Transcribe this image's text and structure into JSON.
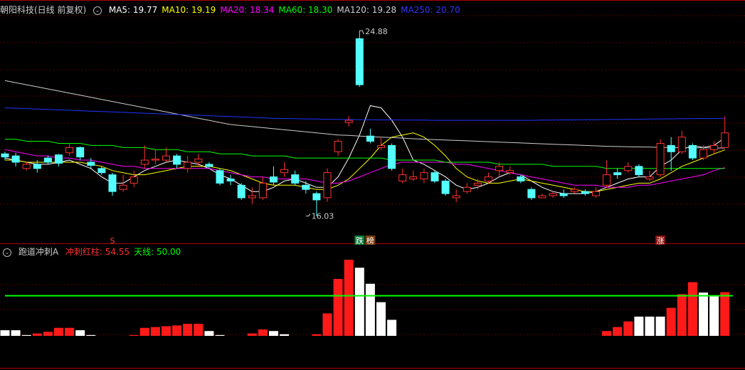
{
  "main_header": {
    "title": "朝阳科技(日线 前复权)",
    "ma_labels": [
      {
        "text": "MA5: 19.77",
        "color": "#ffffff"
      },
      {
        "text": "MA10: 19.19",
        "color": "#ffff00"
      },
      {
        "text": "MA20: 18.34",
        "color": "#ff00ff"
      },
      {
        "text": "MA60: 18.30",
        "color": "#00ff00"
      },
      {
        "text": "MA120: 19.28",
        "color": "#cccccc"
      },
      {
        "text": "MA250: 20.70",
        "color": "#3333ff"
      }
    ]
  },
  "sub_header": {
    "title": "跑道冲刺A",
    "items": [
      {
        "text": "冲刺红柱: 54.55",
        "color": "#ff3333"
      },
      {
        "text": "天线: 50.00",
        "color": "#00ff00"
      }
    ]
  },
  "chart_data": [
    {
      "type": "candlestick",
      "title": "朝阳科技(日线 前复权)",
      "ylim": [
        15.2,
        25.6
      ],
      "annotations": {
        "high": {
          "label": "24.88",
          "value": 24.88,
          "index": 33
        },
        "low": {
          "label": "16.03",
          "value": 16.03,
          "index": 28
        },
        "markers": [
          {
            "text": "S",
            "index": 10,
            "color": "#ff3333"
          },
          {
            "text": "跌",
            "index": 33,
            "color": "#ffffff",
            "bg": "#0a7a3a"
          },
          {
            "text": "榜",
            "index": 34,
            "color": "#ffffff",
            "bg": "#7a3a0a"
          },
          {
            "text": "涨",
            "index": 61,
            "color": "#ffffff",
            "bg": "#8a1010"
          }
        ]
      },
      "candles": [
        [
          19.0,
          18.85,
          19.1,
          18.7
        ],
        [
          18.9,
          18.6,
          19.05,
          18.4
        ],
        [
          18.3,
          18.5,
          18.6,
          18.2
        ],
        [
          18.5,
          18.3,
          18.7,
          18.1
        ],
        [
          18.8,
          18.6,
          18.9,
          18.5
        ],
        [
          18.95,
          18.55,
          19.0,
          18.4
        ],
        [
          19.05,
          19.3,
          19.5,
          18.9
        ],
        [
          19.3,
          18.85,
          19.35,
          18.7
        ],
        [
          18.6,
          18.45,
          18.8,
          18.3
        ],
        [
          18.3,
          18.1,
          18.4,
          18.0
        ],
        [
          18.0,
          17.2,
          18.1,
          17.0
        ],
        [
          17.3,
          17.5,
          18.0,
          17.2
        ],
        [
          17.6,
          17.9,
          18.2,
          17.4
        ],
        [
          18.5,
          18.7,
          19.4,
          18.3
        ],
        [
          18.7,
          18.75,
          19.2,
          18.5
        ],
        [
          18.7,
          18.9,
          19.3,
          18.6
        ],
        [
          18.9,
          18.5,
          19.0,
          18.3
        ],
        [
          18.3,
          18.6,
          18.9,
          18.1
        ],
        [
          18.6,
          18.75,
          19.0,
          18.4
        ],
        [
          18.5,
          18.4,
          18.6,
          18.3
        ],
        [
          18.2,
          17.6,
          18.3,
          17.5
        ],
        [
          17.8,
          17.7,
          18.0,
          17.5
        ],
        [
          17.5,
          16.9,
          17.6,
          16.8
        ],
        [
          16.9,
          17.0,
          17.4,
          16.6
        ],
        [
          16.9,
          17.6,
          17.9,
          16.8
        ],
        [
          17.9,
          17.65,
          18.4,
          17.5
        ],
        [
          18.1,
          18.25,
          18.6,
          17.9
        ],
        [
          18.0,
          17.6,
          18.2,
          17.5
        ],
        [
          17.5,
          17.3,
          17.7,
          17.1
        ],
        [
          17.1,
          16.8,
          17.2,
          16.03
        ],
        [
          16.9,
          18.1,
          18.3,
          16.7
        ],
        [
          19.1,
          19.6,
          19.7,
          18.9
        ],
        [
          20.5,
          20.6,
          20.8,
          20.3
        ],
        [
          24.5,
          22.3,
          24.88,
          22.2
        ],
        [
          19.85,
          19.6,
          20.2,
          19.5
        ],
        [
          19.3,
          19.4,
          19.8,
          19.2
        ],
        [
          19.4,
          18.3,
          19.5,
          18.2
        ],
        [
          17.7,
          18.0,
          18.3,
          17.6
        ],
        [
          17.8,
          17.9,
          18.2,
          17.7
        ],
        [
          17.8,
          18.1,
          18.3,
          17.6
        ],
        [
          18.1,
          17.7,
          18.2,
          17.6
        ],
        [
          17.7,
          17.1,
          17.8,
          17.0
        ],
        [
          16.9,
          17.0,
          17.3,
          16.7
        ],
        [
          17.2,
          17.4,
          17.6,
          17.1
        ],
        [
          17.5,
          17.6,
          17.8,
          17.3
        ],
        [
          17.7,
          17.9,
          18.1,
          17.6
        ],
        [
          18.2,
          18.4,
          18.6,
          17.9
        ],
        [
          18.1,
          18.2,
          18.4,
          18.0
        ],
        [
          17.9,
          17.7,
          18.0,
          17.6
        ],
        [
          17.3,
          16.9,
          17.4,
          16.8
        ],
        [
          16.9,
          17.0,
          17.1,
          16.9
        ],
        [
          17.0,
          17.1,
          17.2,
          16.9
        ],
        [
          17.1,
          17.0,
          17.3,
          16.9
        ],
        [
          17.2,
          17.3,
          17.4,
          17.1
        ],
        [
          17.2,
          17.1,
          17.3,
          17.0
        ],
        [
          17.0,
          17.2,
          17.4,
          16.9
        ],
        [
          17.5,
          18.0,
          18.7,
          17.4
        ],
        [
          18.1,
          18.0,
          18.3,
          17.8
        ],
        [
          18.2,
          18.4,
          18.6,
          18.1
        ],
        [
          18.4,
          18.0,
          18.5,
          17.9
        ],
        [
          17.8,
          17.9,
          18.2,
          17.7
        ],
        [
          18.0,
          19.5,
          19.7,
          17.9
        ],
        [
          19.4,
          19.1,
          19.8,
          18.2
        ],
        [
          19.1,
          19.8,
          20.1,
          19.0
        ],
        [
          19.4,
          18.8,
          19.5,
          18.7
        ],
        [
          18.8,
          19.2,
          19.4,
          18.7
        ],
        [
          19.2,
          19.4,
          19.6,
          19.0
        ],
        [
          19.3,
          20.0,
          20.8,
          19.3
        ]
      ],
      "series": [
        {
          "name": "MA5",
          "color": "#ffffff",
          "values": [
            18.8,
            18.7,
            18.6,
            18.5,
            18.5,
            18.6,
            18.7,
            18.5,
            18.3,
            17.9,
            17.6,
            17.6,
            17.9,
            18.2,
            18.4,
            18.6,
            18.7,
            18.6,
            18.5,
            18.3,
            18.0,
            17.8,
            17.5,
            17.2,
            17.2,
            17.4,
            17.7,
            17.8,
            17.6,
            17.4,
            17.4,
            17.9,
            18.8,
            19.9,
            21.3,
            21.2,
            20.6,
            19.8,
            18.7,
            18.5,
            18.2,
            17.9,
            17.5,
            17.3,
            17.4,
            17.6,
            17.9,
            18.1,
            18.0,
            17.7,
            17.4,
            17.2,
            17.1,
            17.1,
            17.1,
            17.2,
            17.4,
            17.6,
            17.8,
            17.9,
            17.9,
            18.4,
            18.7,
            19.2,
            19.4,
            19.3,
            19.4,
            19.77
          ]
        },
        {
          "name": "MA10",
          "color": "#ffff00",
          "values": [
            18.7,
            18.7,
            18.6,
            18.6,
            18.6,
            18.6,
            18.6,
            18.6,
            18.5,
            18.4,
            18.2,
            18.1,
            18.0,
            18.0,
            18.1,
            18.2,
            18.3,
            18.4,
            18.4,
            18.4,
            18.3,
            18.2,
            18.0,
            17.8,
            17.6,
            17.5,
            17.5,
            17.5,
            17.4,
            17.3,
            17.3,
            17.5,
            17.8,
            18.3,
            18.8,
            19.4,
            19.8,
            19.9,
            20.0,
            19.8,
            19.4,
            18.9,
            18.3,
            17.9,
            17.7,
            17.6,
            17.6,
            17.7,
            17.8,
            17.7,
            17.6,
            17.5,
            17.4,
            17.3,
            17.2,
            17.2,
            17.3,
            17.4,
            17.5,
            17.6,
            17.6,
            17.8,
            18.1,
            18.4,
            18.6,
            18.8,
            19.0,
            19.19
          ]
        },
        {
          "name": "MA20",
          "color": "#ff00ff",
          "values": [
            19.2,
            19.1,
            19.0,
            18.9,
            18.9,
            18.8,
            18.8,
            18.7,
            18.7,
            18.6,
            18.5,
            18.4,
            18.4,
            18.3,
            18.3,
            18.3,
            18.3,
            18.3,
            18.3,
            18.3,
            18.2,
            18.1,
            18.0,
            17.9,
            17.9,
            17.8,
            17.8,
            17.8,
            17.8,
            17.7,
            17.6,
            17.6,
            17.7,
            17.9,
            18.1,
            18.3,
            18.5,
            18.6,
            18.6,
            18.6,
            18.6,
            18.6,
            18.5,
            18.5,
            18.4,
            18.3,
            18.2,
            18.1,
            18.0,
            17.9,
            17.8,
            17.7,
            17.6,
            17.5,
            17.5,
            17.5,
            17.4,
            17.4,
            17.4,
            17.5,
            17.5,
            17.6,
            17.7,
            17.8,
            17.9,
            18.0,
            18.2,
            18.34
          ]
        },
        {
          "name": "MA60",
          "color": "#00ff00",
          "values": [
            19.7,
            19.7,
            19.6,
            19.6,
            19.6,
            19.5,
            19.5,
            19.5,
            19.4,
            19.4,
            19.4,
            19.3,
            19.3,
            19.3,
            19.2,
            19.2,
            19.2,
            19.1,
            19.1,
            19.1,
            19.0,
            19.0,
            19.0,
            18.9,
            18.9,
            18.9,
            18.9,
            18.8,
            18.8,
            18.8,
            18.8,
            18.8,
            18.8,
            18.8,
            18.8,
            18.8,
            18.7,
            18.7,
            18.7,
            18.7,
            18.7,
            18.6,
            18.6,
            18.6,
            18.6,
            18.6,
            18.5,
            18.5,
            18.5,
            18.5,
            18.5,
            18.4,
            18.4,
            18.4,
            18.4,
            18.4,
            18.3,
            18.3,
            18.3,
            18.3,
            18.3,
            18.3,
            18.3,
            18.3,
            18.3,
            18.3,
            18.3,
            18.3
          ]
        },
        {
          "name": "MA120",
          "color": "#cccccc",
          "values": [
            22.5,
            22.4,
            22.3,
            22.2,
            22.1,
            22.0,
            21.9,
            21.8,
            21.7,
            21.6,
            21.5,
            21.4,
            21.3,
            21.2,
            21.1,
            21.0,
            20.9,
            20.8,
            20.7,
            20.6,
            20.5,
            20.4,
            20.35,
            20.3,
            20.25,
            20.2,
            20.15,
            20.1,
            20.05,
            20.0,
            19.95,
            19.9,
            19.88,
            19.85,
            19.82,
            19.8,
            19.78,
            19.75,
            19.72,
            19.7,
            19.68,
            19.66,
            19.64,
            19.62,
            19.6,
            19.58,
            19.56,
            19.54,
            19.52,
            19.5,
            19.48,
            19.46,
            19.44,
            19.42,
            19.4,
            19.38,
            19.36,
            19.35,
            19.34,
            19.33,
            19.32,
            19.31,
            19.3,
            19.3,
            19.29,
            19.29,
            19.28,
            19.28
          ]
        },
        {
          "name": "MA250",
          "color": "#2233ff",
          "values": [
            21.2,
            21.18,
            21.16,
            21.14,
            21.12,
            21.1,
            21.08,
            21.06,
            21.04,
            21.02,
            21.0,
            20.98,
            20.96,
            20.94,
            20.92,
            20.9,
            20.88,
            20.86,
            20.84,
            20.82,
            20.8,
            20.78,
            20.76,
            20.74,
            20.72,
            20.7,
            20.69,
            20.68,
            20.67,
            20.66,
            20.65,
            20.64,
            20.64,
            20.63,
            20.63,
            20.62,
            20.62,
            20.61,
            20.61,
            20.61,
            20.6,
            20.6,
            20.6,
            20.6,
            20.6,
            20.6,
            20.6,
            20.6,
            20.6,
            20.6,
            20.61,
            20.61,
            20.62,
            20.62,
            20.63,
            20.63,
            20.64,
            20.64,
            20.65,
            20.65,
            20.66,
            20.67,
            20.67,
            20.68,
            20.68,
            20.69,
            20.69,
            20.7
          ]
        }
      ]
    },
    {
      "type": "bar",
      "title": "跑道冲刺A",
      "ylim": [
        0,
        100
      ],
      "threshold": {
        "name": "天线",
        "value": 50.0,
        "color": "#00ff00"
      },
      "values": [
        7,
        7,
        1,
        3,
        5,
        10,
        10,
        7,
        1,
        0,
        0,
        0,
        1,
        10,
        11,
        12,
        13,
        15,
        15,
        6,
        1,
        0,
        0,
        3,
        8,
        6,
        2,
        0,
        0,
        2,
        28,
        71,
        95,
        85,
        65,
        42,
        20,
        0,
        0,
        0,
        0,
        0,
        0,
        0,
        0,
        0,
        0,
        0,
        0,
        0,
        0,
        0,
        0,
        0,
        0,
        0,
        6,
        11,
        18,
        24,
        24,
        24,
        35,
        52,
        67,
        54,
        50,
        54.55
      ],
      "colors": [
        "white",
        "white",
        "white",
        "red",
        "red",
        "red",
        "red",
        "white",
        "white",
        "white",
        "white",
        "white",
        "red",
        "red",
        "red",
        "red",
        "red",
        "red",
        "red",
        "white",
        "white",
        "white",
        "white",
        "red",
        "red",
        "white",
        "white",
        "white",
        "white",
        "red",
        "red",
        "red",
        "red",
        "white",
        "white",
        "white",
        "white",
        "white",
        "white",
        "white",
        "white",
        "white",
        "white",
        "white",
        "white",
        "white",
        "white",
        "white",
        "white",
        "white",
        "white",
        "white",
        "white",
        "white",
        "white",
        "white",
        "red",
        "red",
        "red",
        "white",
        "white",
        "white",
        "red",
        "red",
        "red",
        "white",
        "white",
        "red"
      ]
    }
  ]
}
